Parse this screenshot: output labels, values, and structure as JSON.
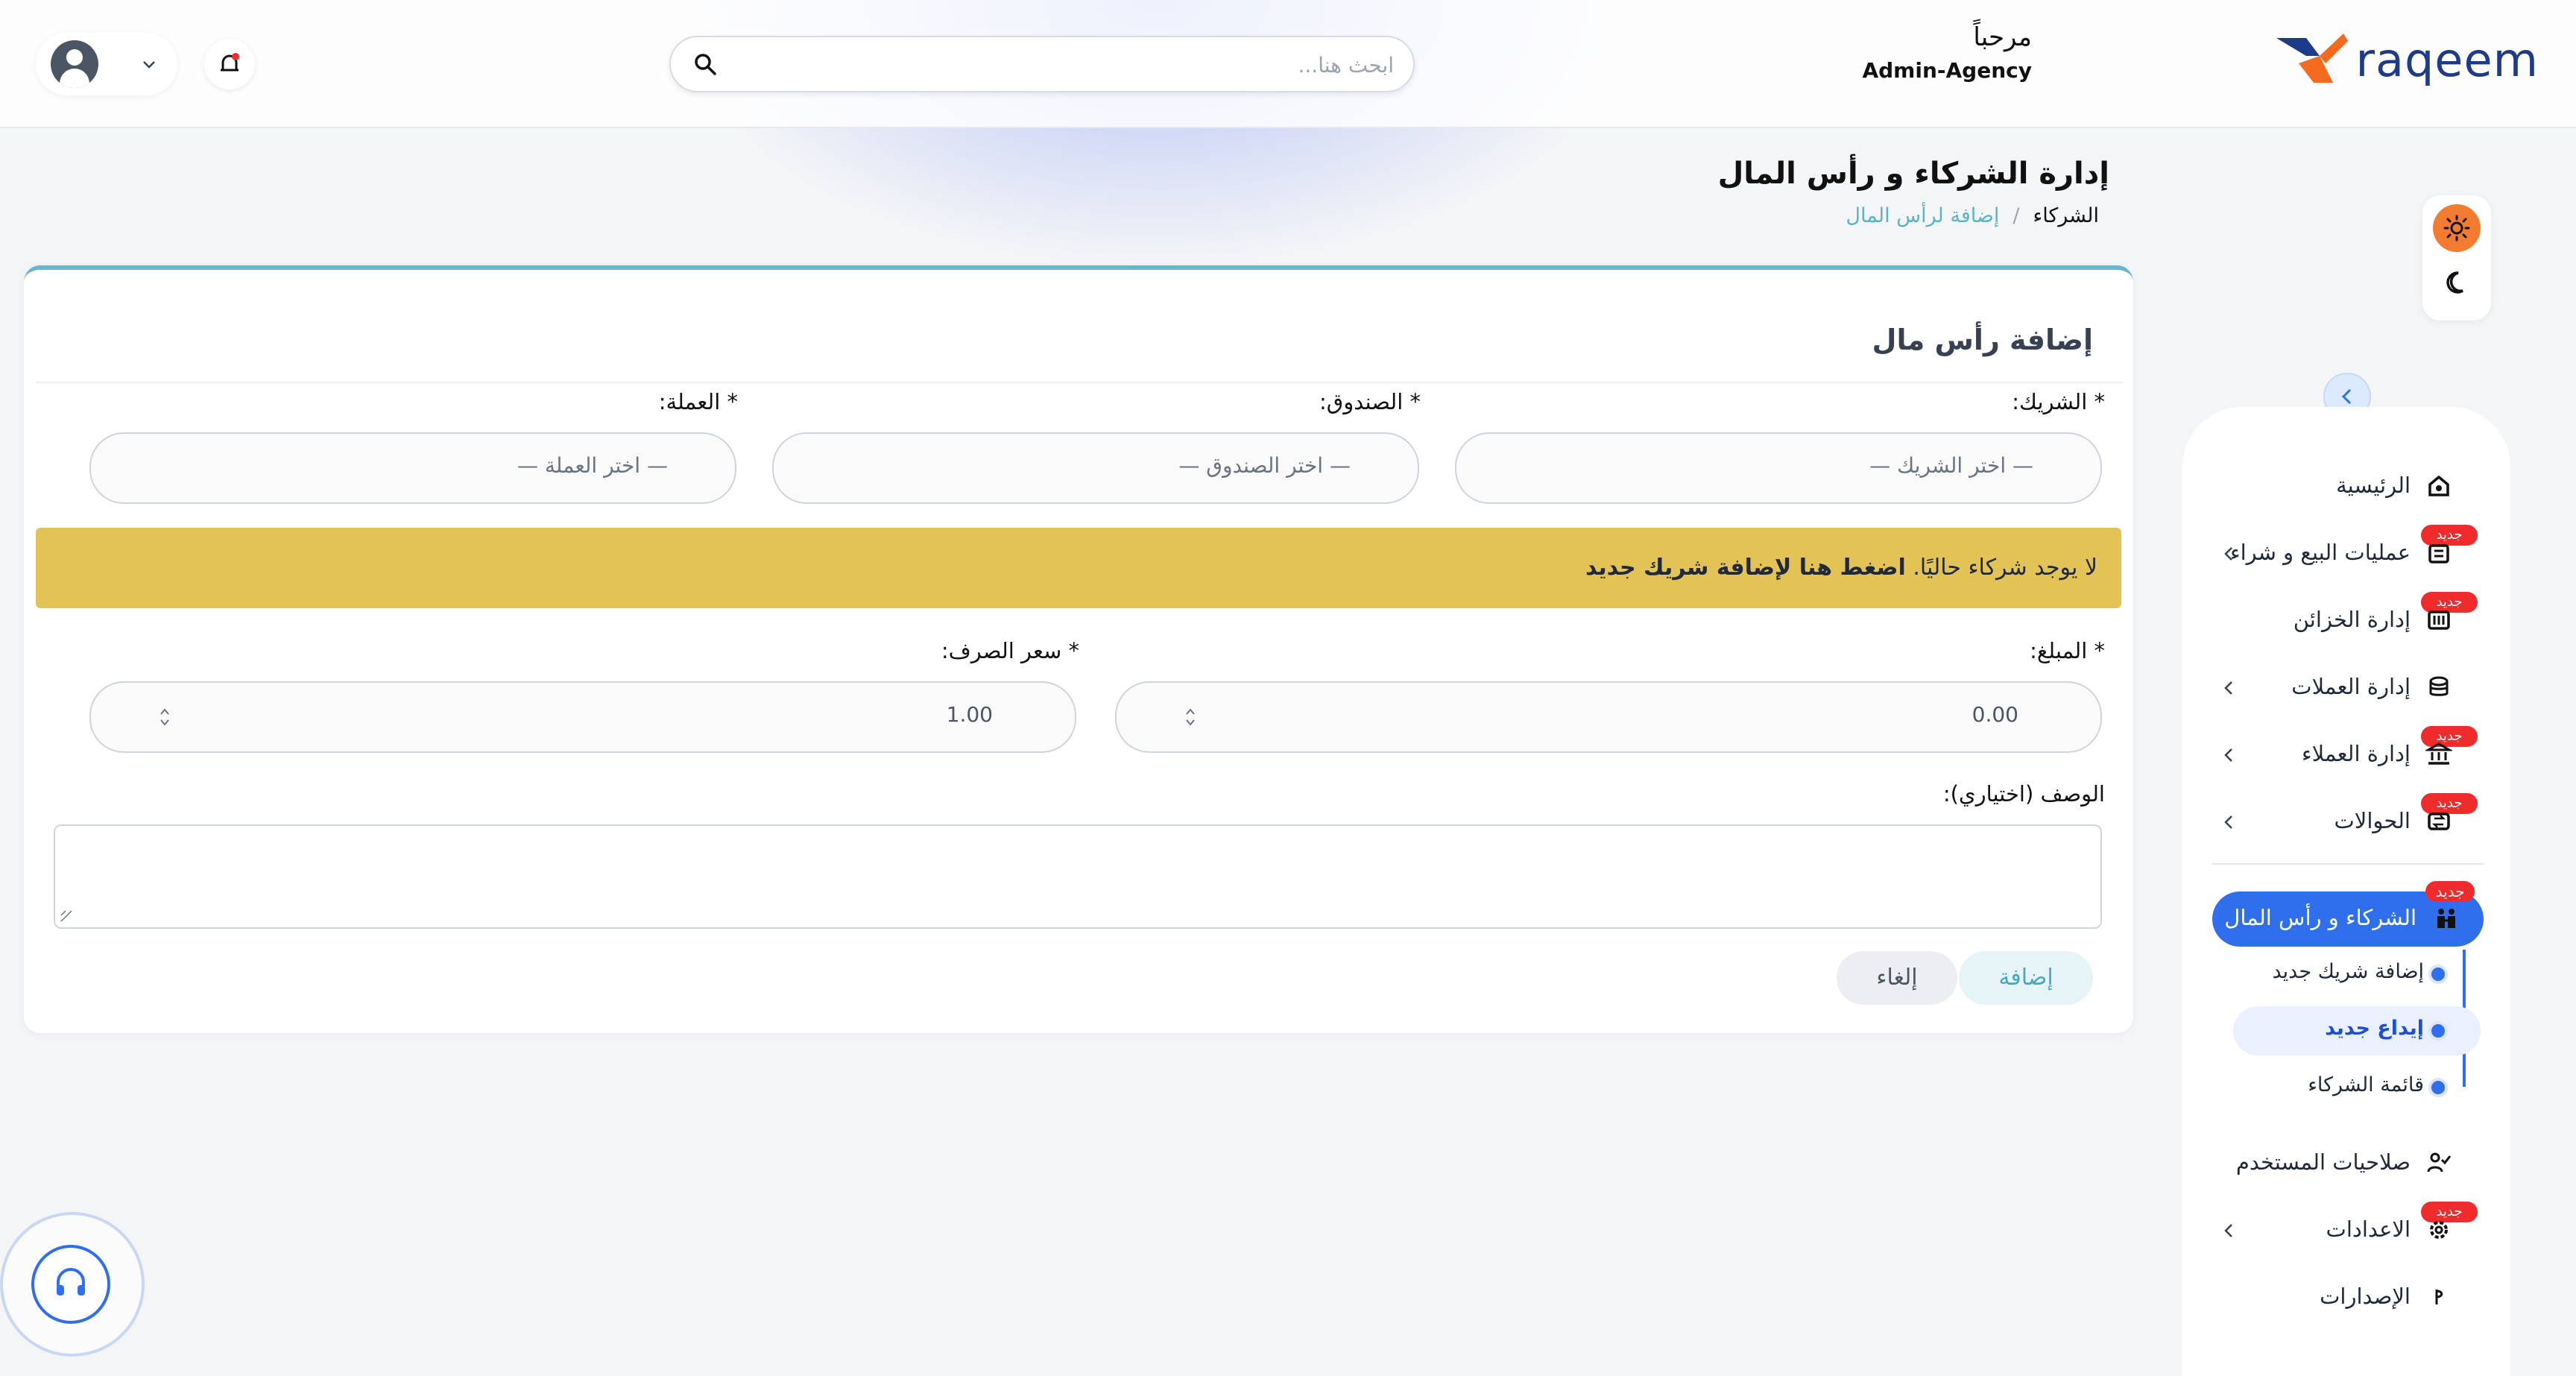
{
  "header": {
    "logo_text": "raqeem",
    "greeting": "مرحباً",
    "role": "Admin-Agency",
    "search_placeholder": "ابحث هنا..."
  },
  "page": {
    "title": "إدارة الشركاء و رأس المال",
    "breadcrumb": [
      "الشركاء",
      "/",
      "إضافة لرأس المال"
    ]
  },
  "sidebar": {
    "items": [
      {
        "label": "الرئيسية",
        "icon": "home-icon",
        "has_arrow": false,
        "badge": ""
      },
      {
        "label": "عمليات البيع و شراء",
        "icon": "exchange-icon",
        "has_arrow": true,
        "badge": "جديد"
      },
      {
        "label": "إدارة الخزائن",
        "icon": "safe-icon",
        "has_arrow": false,
        "badge": "جديد"
      },
      {
        "label": "إدارة العملات",
        "icon": "coins-icon",
        "has_arrow": true,
        "badge": ""
      },
      {
        "label": "إدارة العملاء",
        "icon": "bank-icon",
        "has_arrow": true,
        "badge": "جديد"
      },
      {
        "label": "الحوالات",
        "icon": "transfer-icon",
        "has_arrow": true,
        "badge": "جديد"
      }
    ],
    "active": {
      "label": "الشركاء و رأس المال",
      "badge": "جديد",
      "icon": "partners-icon"
    },
    "subitems": [
      {
        "label": "إضافة شريك جديد",
        "current": false
      },
      {
        "label": "إيداع جديد",
        "current": true
      },
      {
        "label": "قائمة الشركاء",
        "current": false
      }
    ],
    "bottom_items": [
      {
        "label": "صلاحيات المستخدم",
        "icon": "user-permissions-icon",
        "has_arrow": false,
        "badge": ""
      },
      {
        "label": "الاعدادات",
        "icon": "settings-icon",
        "has_arrow": true,
        "badge": "جديد"
      },
      {
        "label": "الإصدارات",
        "icon": "version-icon",
        "has_arrow": false,
        "badge": ""
      }
    ]
  },
  "form": {
    "title": "إضافة رأس مال",
    "partner_label": "* الشريك:",
    "partner_placeholder": "— اختر الشريك —",
    "fund_label": "* الصندوق:",
    "fund_placeholder": "— اختر الصندوق —",
    "currency_label": "* العملة:",
    "currency_placeholder": "— اختر العملة —",
    "alert_text": "لا يوجد شركاء حاليًا.",
    "alert_link": "اضغط هنا لإضافة شريك جديد",
    "amount_label": "* المبلغ:",
    "amount_value": "0.00",
    "rate_label": "* سعر الصرف:",
    "rate_value": "1.00",
    "description_label": "الوصف (اختياري):",
    "add_button": "إضافة",
    "cancel_button": "إلغاء"
  },
  "colors": {
    "primary": "#2f6fed",
    "accent_teal": "#6cb6c9",
    "alert_bg": "#e3c356",
    "badge_red": "#ef2b2b",
    "sun_orange": "#f47c30"
  }
}
